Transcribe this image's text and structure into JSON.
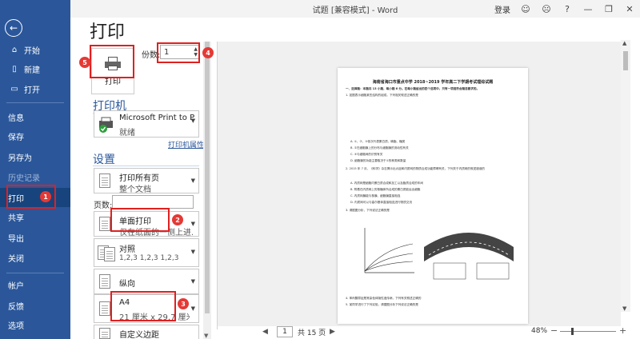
{
  "window": {
    "title": "试题 [兼容模式] - Word",
    "login": "登录",
    "icons": [
      "smile-icon",
      "frown-icon",
      "help-icon",
      "minimize-icon",
      "restore-icon",
      "close-icon"
    ]
  },
  "sidebar": {
    "back_icon": "back-arrow-icon",
    "items": [
      {
        "label": "开始",
        "icon": "home-icon"
      },
      {
        "label": "新建",
        "icon": "new-doc-icon"
      },
      {
        "label": "打开",
        "icon": "folder-icon"
      },
      {
        "label": "信息"
      },
      {
        "label": "保存"
      },
      {
        "label": "另存为"
      },
      {
        "label": "历史记录"
      },
      {
        "label": "打印"
      },
      {
        "label": "共享"
      },
      {
        "label": "导出"
      },
      {
        "label": "关闭"
      },
      {
        "label": "帐户"
      },
      {
        "label": "反馈"
      },
      {
        "label": "选项"
      }
    ]
  },
  "print": {
    "page_title": "打印",
    "print_button_label": "打印",
    "copies_label": "份数:",
    "copies_value": "1",
    "printer_heading": "打印机",
    "printer_name": "Microsoft Print to P...",
    "printer_status": "就绪",
    "printer_properties_link": "打印机属性",
    "settings_heading": "设置",
    "settings": [
      {
        "line1": "打印所有页",
        "line2": "整个文档"
      },
      {
        "line1": "单面打印",
        "line2": "仅在纸面的一侧上进..."
      },
      {
        "line1": "对照",
        "line2": "1,2,3    1,2,3    1,2,3"
      },
      {
        "line1": "纵向",
        "line2": ""
      },
      {
        "line1": "A4",
        "line2": "21 厘米 x 29.7 厘米"
      },
      {
        "line1": "自定义边距",
        "line2": ""
      }
    ],
    "pages_label": "页数:",
    "pages_value": ""
  },
  "preview": {
    "doc_title": "海南省海口市重点中学 2018~2019 学年高二下学期考试理综试题",
    "lines": [
      "一、选择题：本题共 13 小题，每小题 6 分。在每小题给出的四个选项中，只有一项是符合题目要求的。",
      "1. 如图表示细胞某些结构的组成，下列相关叙述正确的是",
      "A. ①、②、③依次代表蛋白质、磷脂、糖类",
      "B. ②在细胞膜上的分布与细胞膜的流动性有关",
      "C. ③与细胞间的识别有关",
      "D. 细胞膜的功能主要取决于①的种类和数量",
      "2. 2015 年 7 月，《科学》杂志揭示出炎症和内质网的物质合成功能障碍有关，下列关于内质网的叙述错误的",
      "A. 内质网是细胞内蛋白质合成和加工以及脂质合成的车间",
      "B. 附着在内质网上的核糖体所合成的蛋白质能运出细胞",
      "C. 内质网膜能与核膜、细胞膜直接相连",
      "D. 内质网可以与高尔基体直接相连进行物质交流",
      "3. 请据图分析，下列说法正确的是",
      "4. 苯丙酮尿症是常染色体隐性遗传病，下列有关叙述正确的",
      "5. 某同学进行了下列实验，请据图分析下列说法正确的是"
    ]
  },
  "statusbar": {
    "current_page": "1",
    "total_pages": "共 15 页",
    "prev": "◀",
    "next": "▶",
    "zoom": "48%",
    "zoom_minus": "−",
    "zoom_plus": "+",
    "zoom_level_percent": 48
  },
  "annotations": [
    "1",
    "2",
    "3",
    "4",
    "5"
  ],
  "colors": {
    "accent": "#2b579a",
    "sidebar_active": "#18447d",
    "annotation": "#e02020"
  }
}
